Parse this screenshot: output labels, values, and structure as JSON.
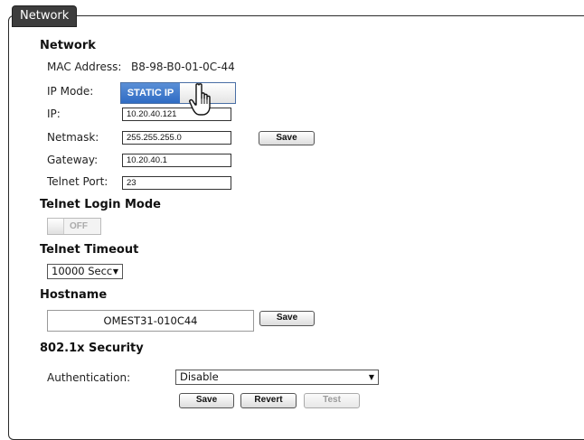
{
  "section_tab": "Network",
  "network": {
    "heading": "Network",
    "mac_label": "MAC Address:",
    "mac_value": "B8-98-B0-01-0C-44",
    "ip_mode_label": "IP Mode:",
    "ip_mode_value": "STATIC IP",
    "ip_label": "IP:",
    "ip_value": "10.20.40.121",
    "netmask_label": "Netmask:",
    "netmask_value": "255.255.255.0",
    "gateway_label": "Gateway:",
    "gateway_value": "10.20.40.1",
    "telnet_port_label": "Telnet Port:",
    "telnet_port_value": "23",
    "save_label": "Save"
  },
  "telnet_login": {
    "heading": "Telnet Login Mode",
    "toggle_label": "OFF"
  },
  "telnet_timeout": {
    "heading": "Telnet Timeout",
    "selected": "10000 Secc"
  },
  "hostname": {
    "heading": "Hostname",
    "value": "OMEST31-010C44",
    "save_label": "Save"
  },
  "security": {
    "heading": "802.1x Security",
    "auth_label": "Authentication:",
    "auth_selected": "Disable",
    "save_label": "Save",
    "revert_label": "Revert",
    "test_label": "Test"
  },
  "icons": {
    "cursor": "hand-pointer-icon",
    "dropdown": "caret-down-icon"
  }
}
